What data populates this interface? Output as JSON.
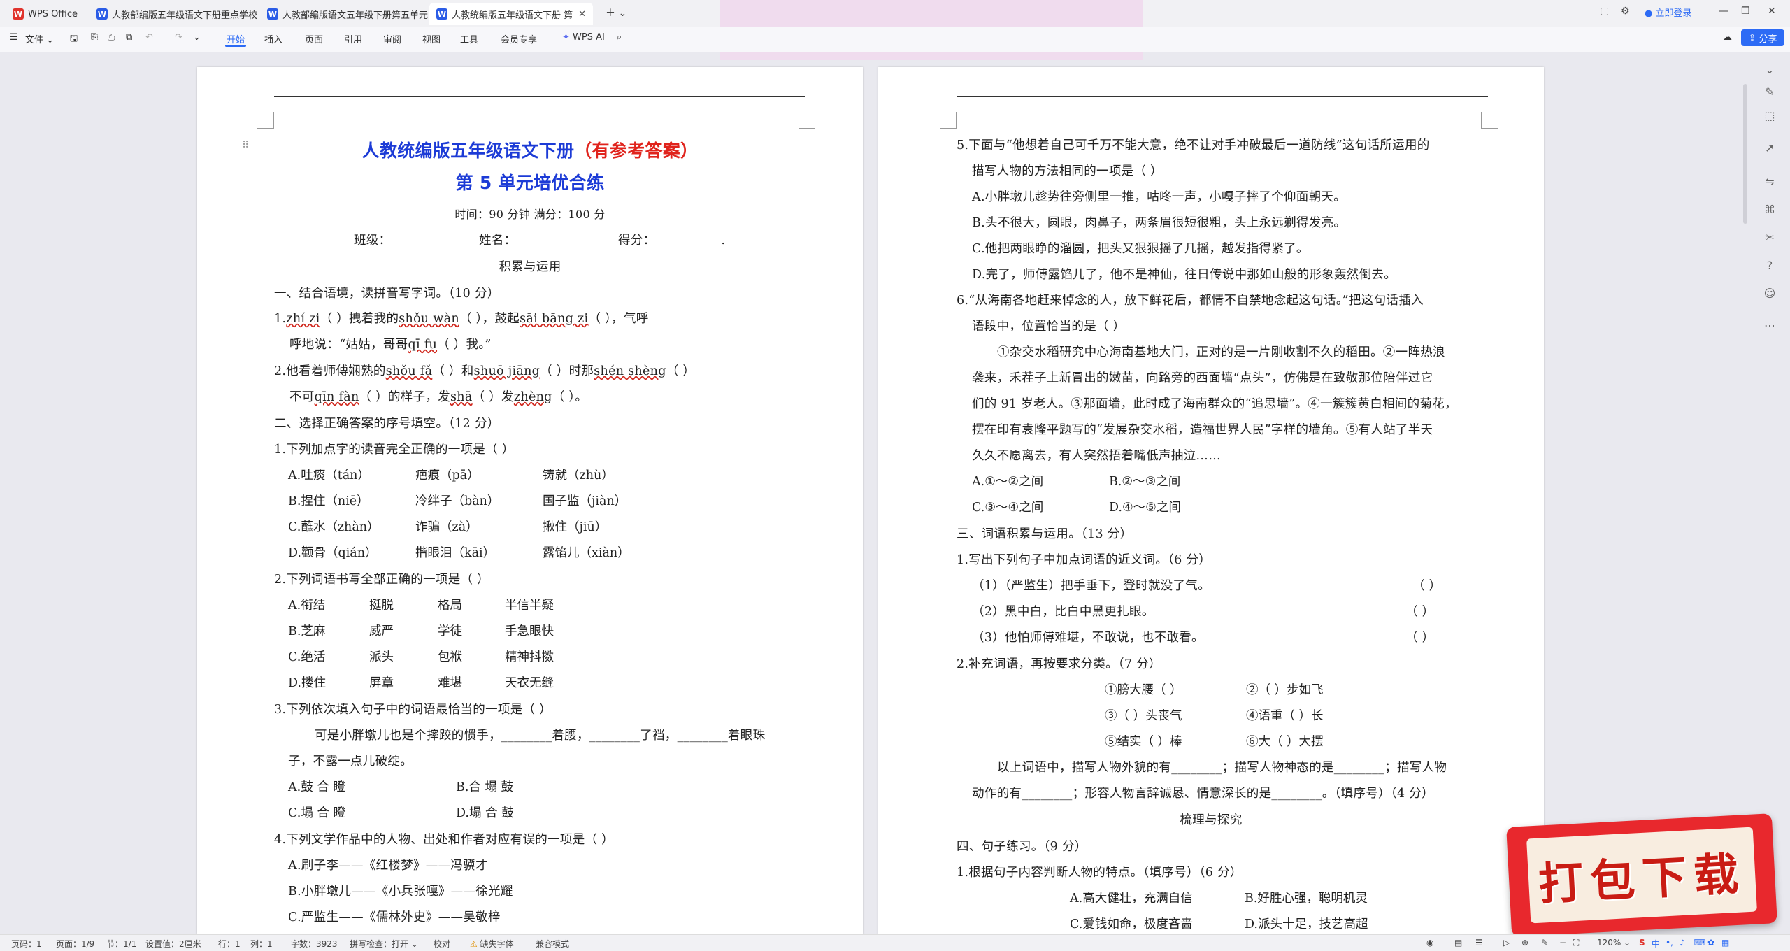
{
  "titlebar": {
    "tabs": [
      {
        "label": "WPS Office",
        "icon": "wps-logo"
      },
      {
        "label": "人教部编版五年级语文下册重点学校",
        "icon": "word-doc-icon"
      },
      {
        "label": "人教部编版语文五年级下册第五单元",
        "icon": "word-doc-icon"
      },
      {
        "label": "人教统编版五年级语文下册 第",
        "icon": "word-doc-icon",
        "active": true
      }
    ],
    "login": "立即登录"
  },
  "ribbon": {
    "file": "文件",
    "tabs": [
      "开始",
      "插入",
      "页面",
      "引用",
      "审阅",
      "视图",
      "工具",
      "会员专享"
    ],
    "ai": "WPS AI",
    "share": "分享"
  },
  "page1": {
    "title": "人教统编版五年级语文下册",
    "title_red": "（有参考答案）",
    "subtitle": "第 5 单元培优合练",
    "time_line": "时间：90 分钟  满分：100 分",
    "info_class": "班级：",
    "info_name": "姓名：",
    "info_score": "得分：",
    "section_title": "积累与运用",
    "s1": "一、结合语境，读拼音写字词。（10 分）",
    "q1_a": "1.",
    "q1_p1": "zhí zi",
    "q1_b": "（        ）拽着我的",
    "q1_p2": "shǒu wàn",
    "q1_c": "（        ），鼓起",
    "q1_p3": "sāi bāng zi",
    "q1_d": "（        ），气呼",
    "q1_l2a": "呼地说：“姑姑，哥哥",
    "q1_p4": "qī fu",
    "q1_l2b": "（        ）我。”",
    "q2_a": "2.他看着师傅娴熟的",
    "q2_p1": "shǒu fǎ",
    "q2_b": "（        ）和",
    "q2_p2": "shuō jiāng",
    "q2_c": "（        ）时那",
    "q2_p3": "shén shèng",
    "q2_d": "（        ）",
    "q2_l2a": "不可",
    "q2_p4": "qīn fàn",
    "q2_l2b": "（        ）的样子，发",
    "q2_p5": "shā",
    "q2_l2c": "（     ）发",
    "q2_p6": "zhèng",
    "q2_l2d": "（     ）。",
    "s2": "二、选择正确答案的序号填空。（12 分）",
    "c1": "1.下列加点字的读音完全正确的一项是（     ）",
    "c1_opts": [
      [
        "A.吐痰（tán）",
        "疤痕（pā）",
        "铸就（zhù）"
      ],
      [
        "B.捏住（niē）",
        "冷绊子（bàn）",
        "国子监（jiàn）"
      ],
      [
        "C.蘸水（zhàn）",
        "诈骗（zà）",
        "揪住（jiū）"
      ],
      [
        "D.颧骨（qián）",
        "揩眼泪（kāi）",
        "露馅儿（xiàn）"
      ]
    ],
    "c2": "2.下列词语书写全部正确的一项是（     ）",
    "c2_opts": [
      [
        "A.衔结",
        "挺脱",
        "格局",
        "半信半疑"
      ],
      [
        "B.芝麻",
        "威严",
        "学徒",
        "手急眼快"
      ],
      [
        "C.绝活",
        "派头",
        "包袱",
        "精神抖擞"
      ],
      [
        "D.搂住",
        "屏章",
        "难堪",
        "天衣无缝"
      ]
    ],
    "c3": "3.下列依次填入句子中的词语最恰当的一项是（     ）",
    "c3_text1": "可是小胖墩儿也是个摔跤的惯手，________着腰，________了裆，________着眼珠",
    "c3_text2": "子，不露一点儿破绽。",
    "c3_opts": [
      [
        "A.鼓  合  瞪",
        "B.合  塌  鼓"
      ],
      [
        "C.塌  合  瞪",
        "D.塌  合  鼓"
      ]
    ],
    "c4": "4.下列文学作品中的人物、出处和作者对应有误的一项是（     ）",
    "c4_opts": [
      "A.刷子李——《红楼梦》——冯骥才",
      "B.小胖墩儿——《小兵张嘎》——徐光耀",
      "C.严监生——《儒林外史》——吴敬梓"
    ]
  },
  "page2": {
    "q5_1": "5.下面与“他想着自己可千万不能大意，绝不让对手冲破最后一道防线”这句话所运用的",
    "q5_2": "描写人物的方法相同的一项是（     ）",
    "q5_opts": [
      "A.小胖墩儿趁势往旁侧里一推，咕咚一声，小嘎子摔了个仰面朝天。",
      "B.头不很大，圆眼，肉鼻子，两条眉很短很粗，头上永远剃得发亮。",
      "C.他把两眼睁的溜圆，把头又狠狠摇了几摇，越发指得紧了。",
      "D.完了，师傅露馅儿了，他不是神仙，往日传说中那如山般的形象轰然倒去。"
    ],
    "q6_1": "6.“从海南各地赶来悼念的人，放下鲜花后，都情不自禁地念起这句话。”把这句话插入",
    "q6_2": "语段中，位置恰当的是（     ）",
    "q6_p1": "①杂交水稻研究中心海南基地大门，正对的是一片刚收割不久的稻田。②一阵热浪",
    "q6_p2": "袭来，禾茬子上新冒出的嫩苗，向路旁的西面墙“点头”，仿佛是在致敬那位陪伴过它",
    "q6_p3": "们的 91 岁老人。③那面墙，此时成了海南群众的“追思墙”。④一簇簇黄白相间的菊花，",
    "q6_p4": "摆在印有袁隆平题写的“发展杂交水稻，造福世界人民”字样的墙角。⑤有人站了半天",
    "q6_p5": "久久不愿离去，有人突然捂着嘴低声抽泣……",
    "q6_opts": [
      [
        "A.①～②之间",
        "B.②～③之间"
      ],
      [
        "C.③～④之间",
        "D.④～⑤之间"
      ]
    ],
    "s3": "三、词语积累与运用。（13 分）",
    "w1": "1.写出下列句子中加点词语的近义词。（6 分）",
    "w1_items": [
      {
        "text": "（1）（严监生）把手垂下，登时就没了气。",
        "ans": "（          ）"
      },
      {
        "text": "（2）黑中白，比白中黑更扎眼。",
        "ans": "（          ）"
      },
      {
        "text": "（3）他怕师傅难堪，不敢说，也不敢看。",
        "ans": "（          ）"
      }
    ],
    "w2": "2.补充词语，再按要求分类。（7 分）",
    "w2_rows": [
      [
        "①膀大腰（     ）",
        "②（     ）步如飞"
      ],
      [
        "③（     ）头丧气",
        "④语重（     ）长"
      ],
      [
        "⑤结实（     ）棒",
        "⑥大（     ）大摆"
      ]
    ],
    "w2_q1": "以上词语中，描写人物外貌的有________；描写人物神态的是________；描写人物",
    "w2_q2": "动作的有________；形容人物言辞诚恳、情意深长的是________。（填序号）（4 分）",
    "section2": "梳理与探究",
    "s4": "四、句子练习。（9 分）",
    "s4_1": "1.根据句子内容判断人物的特点。（填序号）（6 分）",
    "s4_opts": [
      [
        "A.高大健壮，充满自信",
        "B.好胜心强，聪明机灵"
      ],
      [
        "C.爱钱如命，极度吝啬",
        "D.派头十足，技艺高超"
      ]
    ]
  },
  "statusbar": {
    "page": "页码：1",
    "pages": "页面：1/9",
    "section": "节：1/1",
    "setting": "设置值：2厘米",
    "row": "行：1",
    "col": "列：1",
    "words": "字数：3923",
    "spell": "拼写检查：打开",
    "proof": "校对",
    "missing_font": "缺失字体",
    "compat": "兼容模式",
    "zoom": "120%"
  },
  "sticker": {
    "text": "打包下载"
  }
}
